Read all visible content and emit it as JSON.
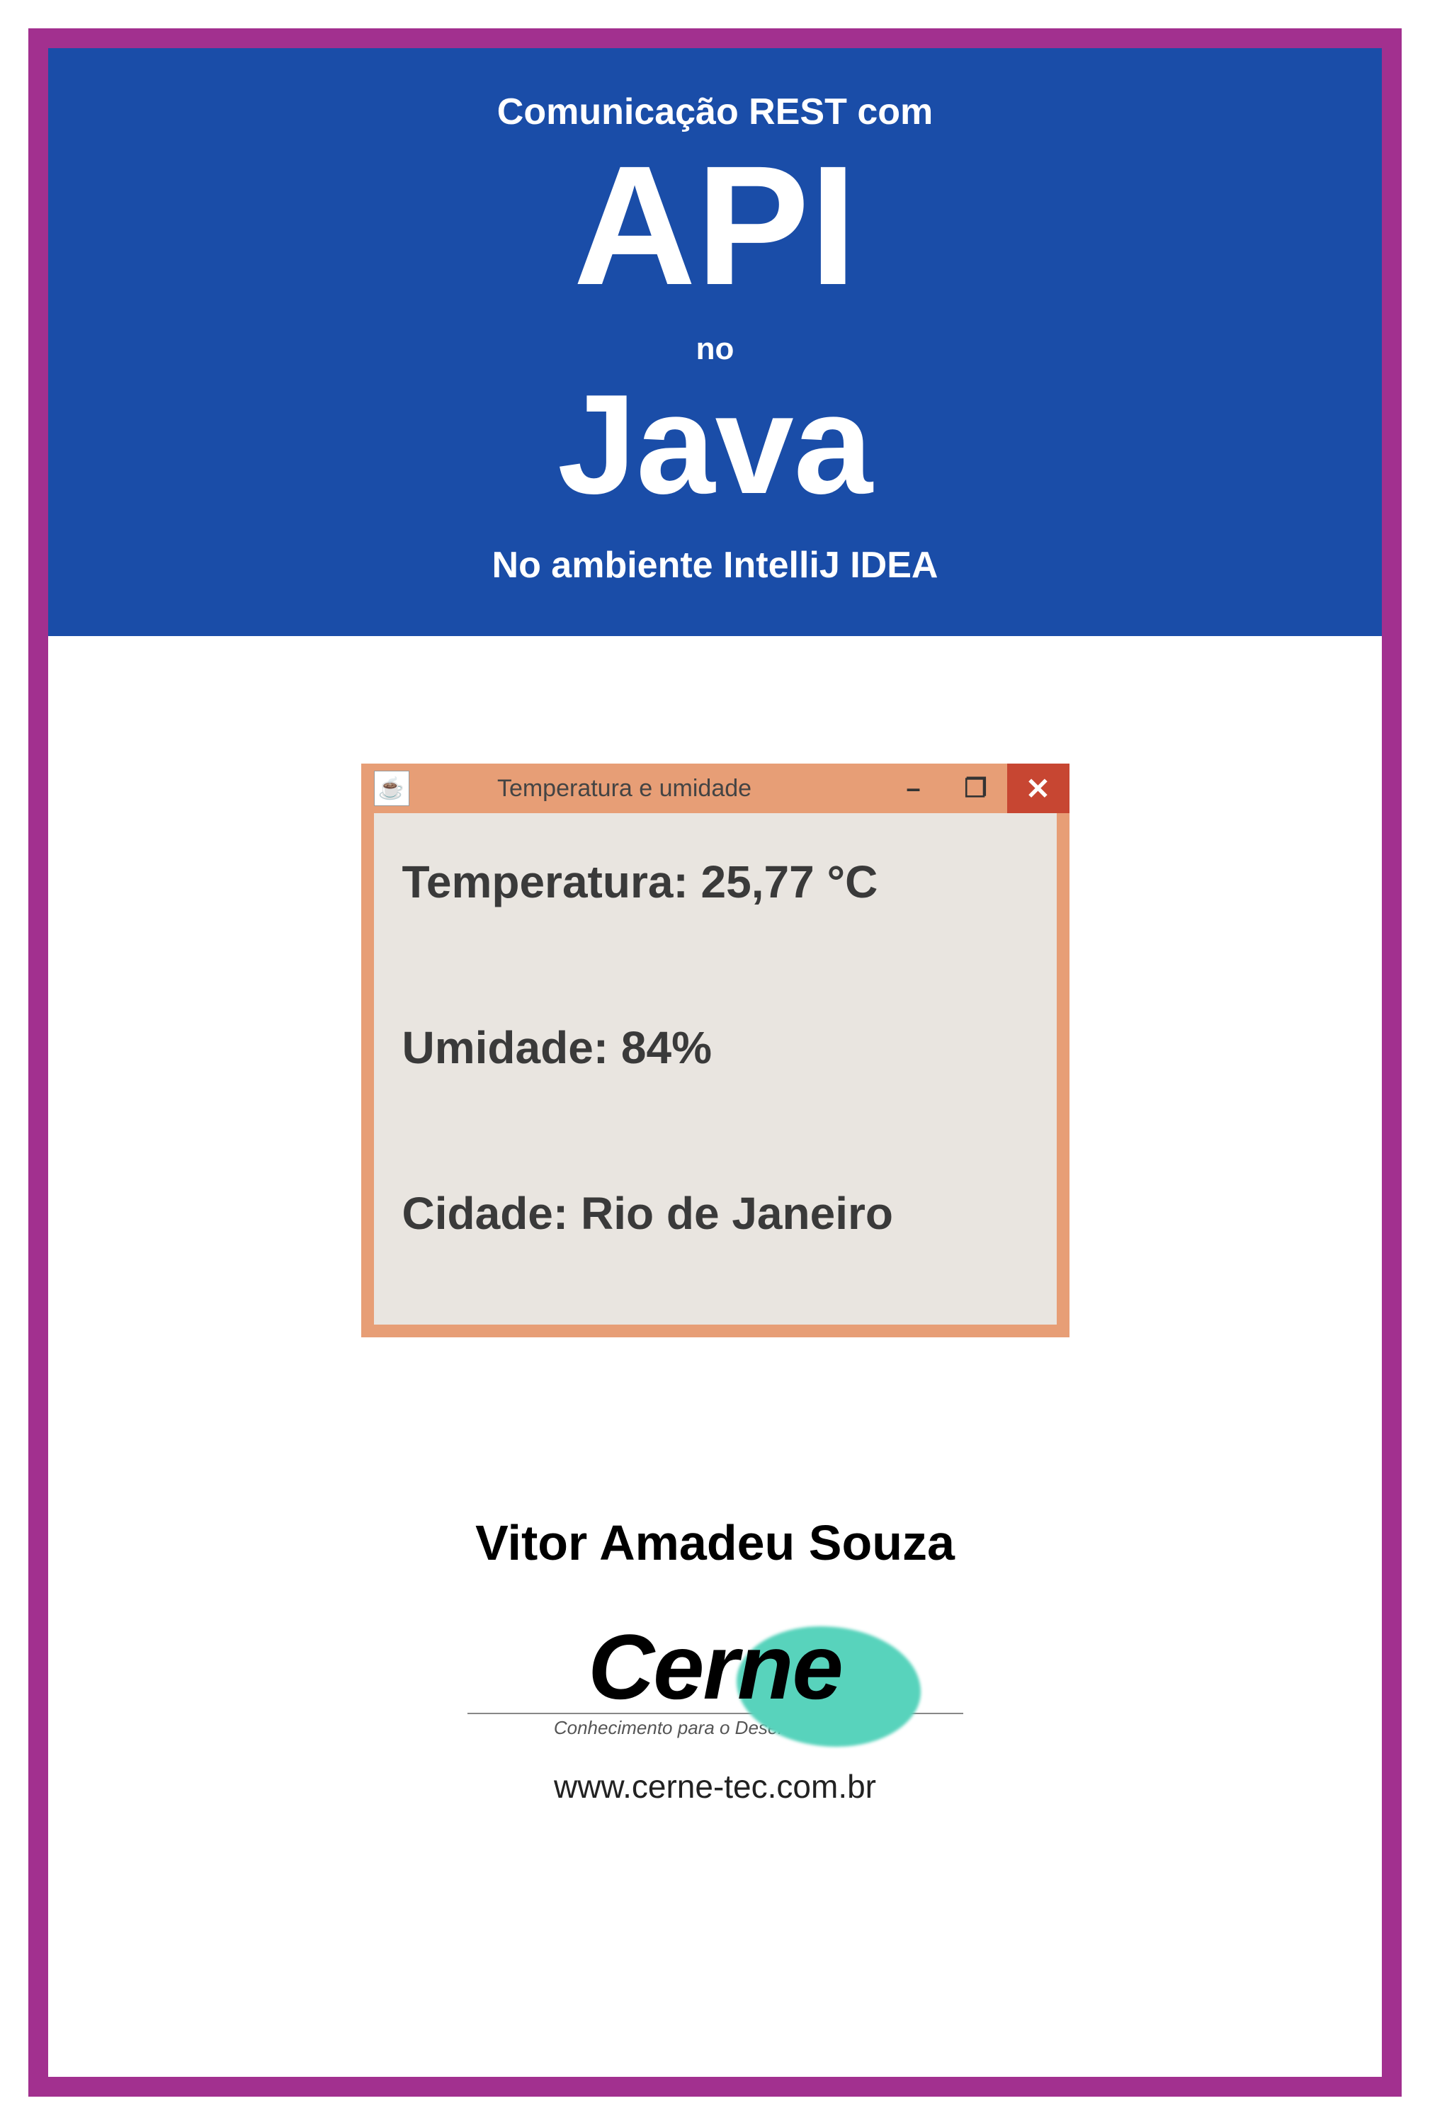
{
  "header": {
    "line1": "Comunicação REST com",
    "api": "API",
    "no": "no",
    "java": "Java",
    "ide": "No ambiente IntelliJ IDEA"
  },
  "window": {
    "title": "Temperatura e umidade",
    "temperature_label": "Temperatura:",
    "temperature_value": "25,77 °C",
    "humidity_label": "Umidade:",
    "humidity_value": "84%",
    "city_label": "Cidade:",
    "city_value": "Rio de Janeiro",
    "minimize": "–",
    "maximize": "❐",
    "close": "✕"
  },
  "author": "Vitor Amadeu Souza",
  "logo": {
    "name": "Cerne",
    "tagline": "Conhecimento para o Desenvolvimento",
    "website": "www.cerne-tec.com.br"
  }
}
